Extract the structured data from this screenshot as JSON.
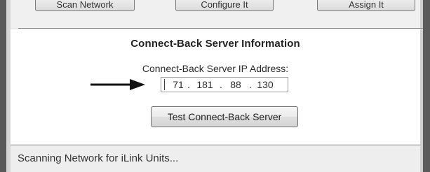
{
  "toolbar": {
    "buttons": [
      {
        "label": "Scan Network"
      },
      {
        "label": "Configure It"
      },
      {
        "label": "Assign It"
      }
    ]
  },
  "connect_back": {
    "title": "Connect-Back Server Information",
    "ip_label": "Connect-Back Server IP Address:",
    "ip_octets": [
      "71",
      "181",
      "88",
      "130"
    ],
    "test_button_label": "Test Connect-Back Server"
  },
  "status_bar": {
    "text": "Scanning Network for iLink Units..."
  },
  "icons": {
    "arrow": "arrow-right-icon"
  }
}
